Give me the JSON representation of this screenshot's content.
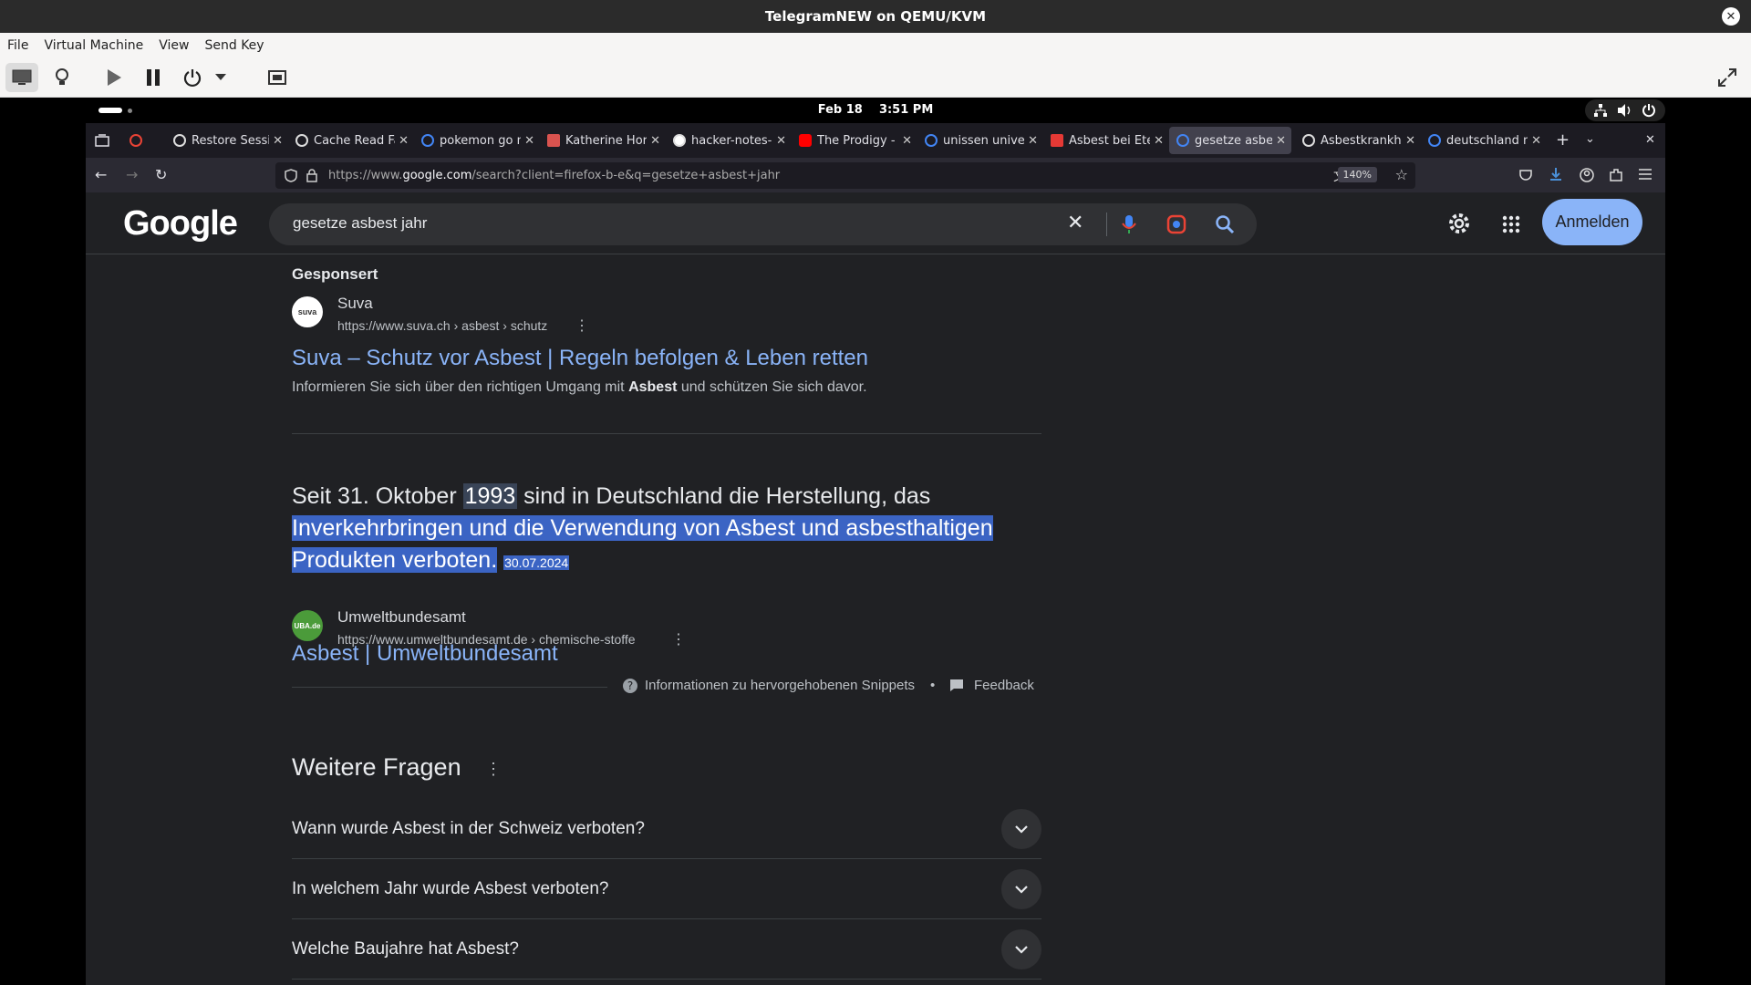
{
  "window": {
    "title": "TelegramNEW on QEMU/KVM",
    "close": "✕"
  },
  "menubar": {
    "items": [
      "File",
      "Virtual Machine",
      "View",
      "Send Key"
    ]
  },
  "gnome": {
    "date": "Feb 18",
    "time": "3:51 PM"
  },
  "tabs": [
    {
      "title": "",
      "color": "#ea4335"
    },
    {
      "title": "Restore Sessio",
      "color": "#dddddd"
    },
    {
      "title": "Cache Read Fa",
      "color": "#dddddd"
    },
    {
      "title": "pokemon go m",
      "color": "#4285f4"
    },
    {
      "title": "Katherine Hor",
      "color": "#d9534f"
    },
    {
      "title": "hacker-notes-",
      "color": "#ffffff"
    },
    {
      "title": "The Prodigy -",
      "color": "#ff0000"
    },
    {
      "title": "unissen unive",
      "color": "#4285f4"
    },
    {
      "title": "Asbest bei Ete",
      "color": "#e53935"
    },
    {
      "title": "gesetze asbes",
      "color": "#4285f4"
    },
    {
      "title": "Asbestkrankhe",
      "color": "#dddddd"
    },
    {
      "title": "deutschland m",
      "color": "#4285f4"
    }
  ],
  "navbar": {
    "url_prefix": "https://www.",
    "url_domain": "google.com",
    "url_rest": "/search?client=firefox-b-e&q=gesetze+asbest+jahr",
    "zoom": "140%"
  },
  "google": {
    "logo": "Google",
    "query": "gesetze asbest jahr",
    "signin": "Anmelden",
    "sponsored": "Gesponsert",
    "ad": {
      "favicon_text": "suva",
      "site": "Suva",
      "url": "https://www.suva.ch › asbest › schutz",
      "title": "Suva – Schutz vor Asbest | Regeln befolgen & Leben retten",
      "snippet_pre": "Informieren Sie sich über den richtigen Umgang mit ",
      "snippet_bold": "Asbest",
      "snippet_post": " und schützen Sie sich davor."
    },
    "featured": {
      "pre": "Seit 31. Oktober ",
      "year": "1993",
      "mid": " sind in Deutschland die Herstellung, das",
      "highlight": "Inverkehrbringen und die Verwendung von Asbest und asbesthaltigen Produkten verboten.",
      "date": "30.07.2024"
    },
    "result": {
      "favicon_text": "UBA.de",
      "site": "Umweltbundesamt",
      "url": "https://www.umweltbundesamt.de › chemische-stoffe",
      "title": "Asbest | Umweltbundesamt"
    },
    "info_text": "Informationen zu hervorgehobenen Snippets",
    "feedback": "Feedback",
    "more_questions": "Weitere Fragen",
    "questions": [
      "Wann wurde Asbest in der Schweiz verboten?",
      "In welchem Jahr wurde Asbest verboten?",
      "Welche Baujahre hat Asbest?"
    ]
  }
}
